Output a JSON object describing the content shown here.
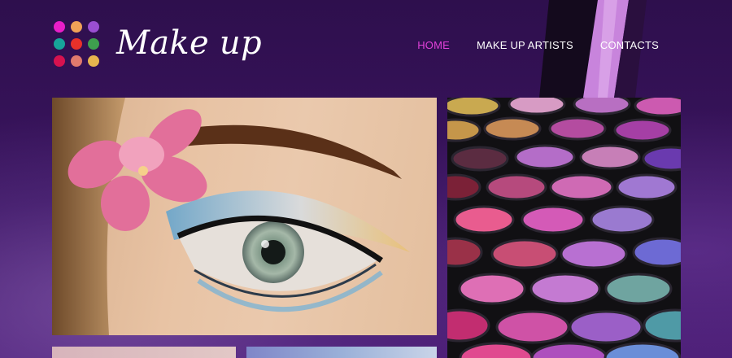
{
  "brand": {
    "title": "Make up",
    "dot_colors": [
      "#e91ec8",
      "#f0a257",
      "#9a4fd2",
      "#17a59a",
      "#e8312a",
      "#3e9f4e",
      "#d6124f",
      "#e07a6d",
      "#e7b54e"
    ]
  },
  "nav": {
    "items": [
      {
        "label": "HOME",
        "active": true
      },
      {
        "label": "MAKE UP ARTISTS",
        "active": false
      },
      {
        "label": "CONTACTS",
        "active": false
      }
    ]
  },
  "colors": {
    "accent": "#e040d8",
    "background": "#2a0d45"
  },
  "images": {
    "main": "eye-makeup-photo",
    "side": "eyeshadow-palette-photo",
    "thumbs": [
      "portrait-photo",
      "flowers-photo"
    ]
  }
}
